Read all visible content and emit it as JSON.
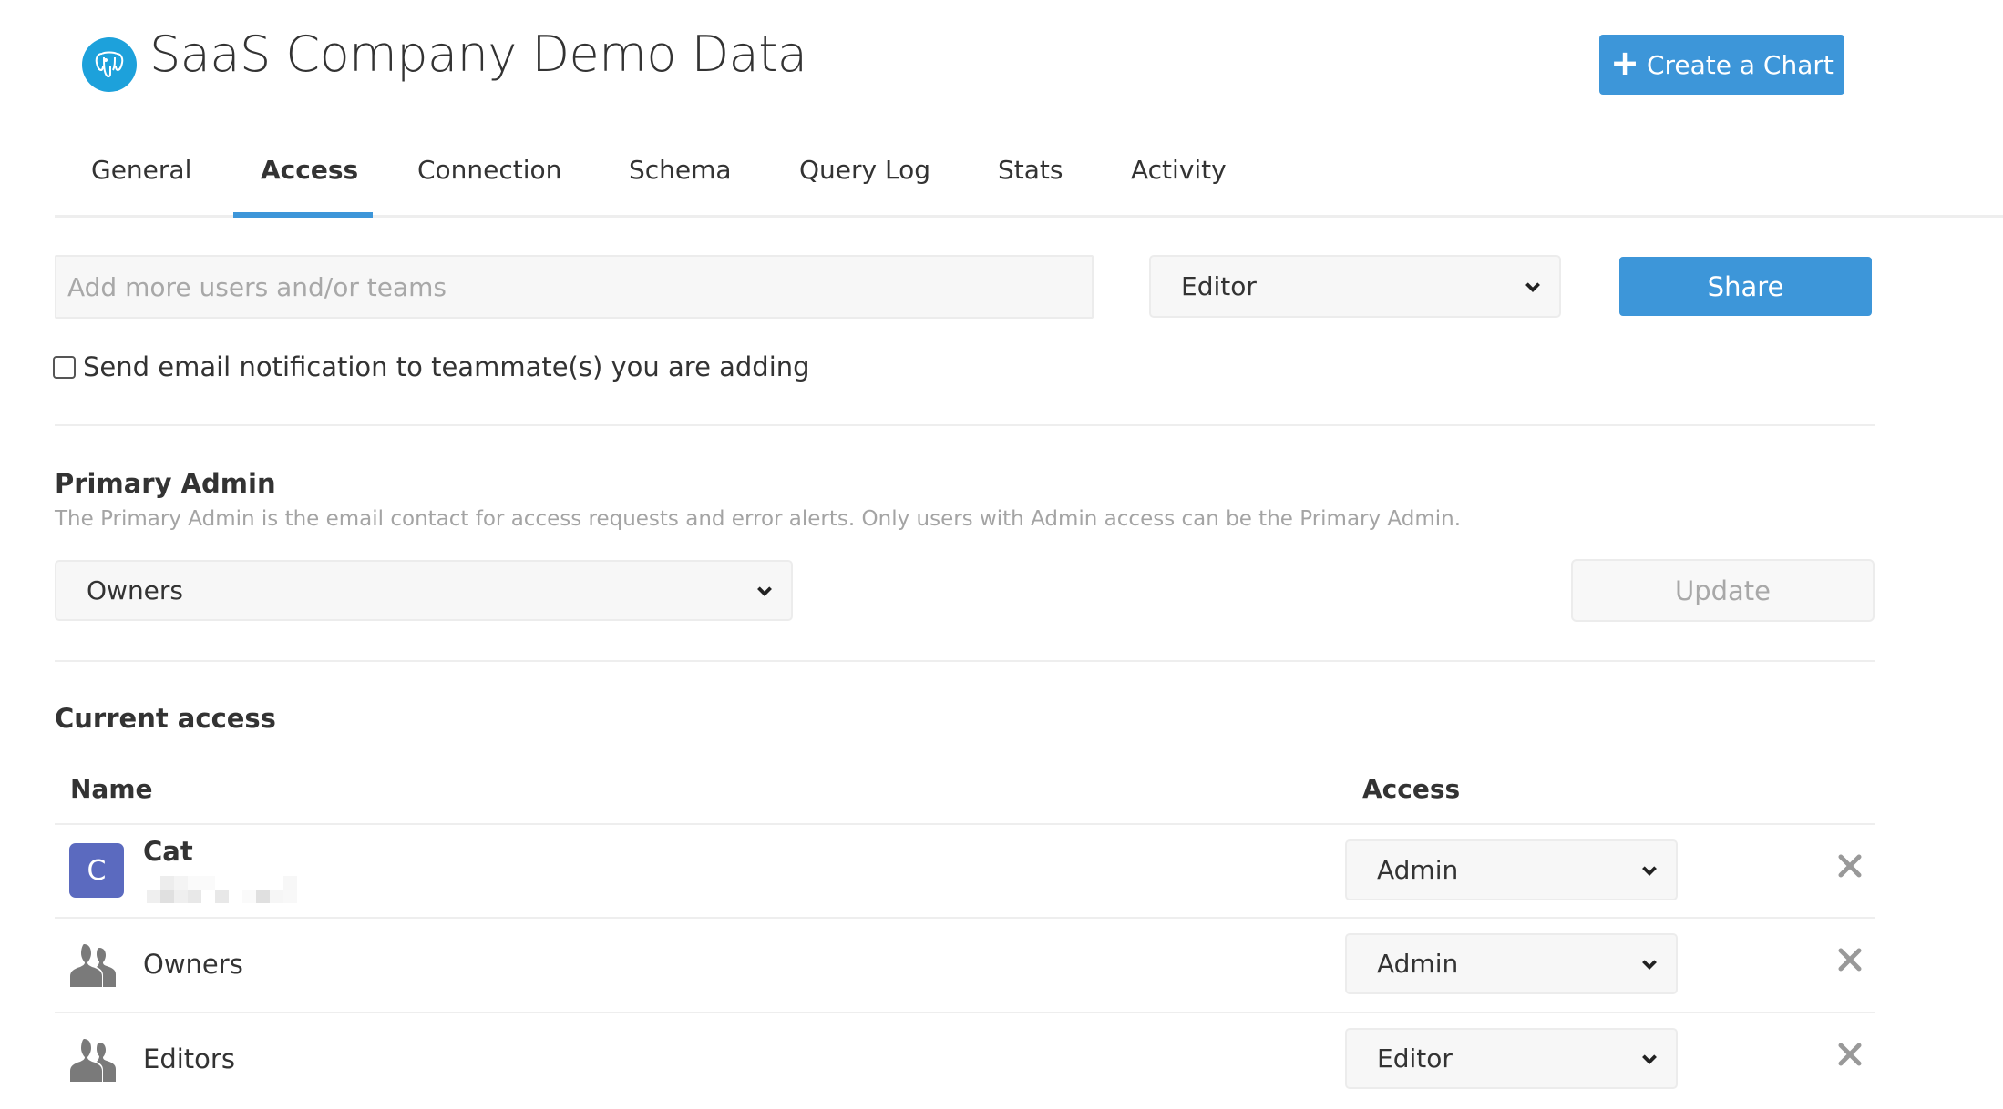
{
  "header": {
    "title": "SaaS Company Demo Data",
    "logo_icon": "postgresql-elephant-icon",
    "create_chart_label": "Create a Chart"
  },
  "tabs": [
    {
      "label": "General",
      "active": false
    },
    {
      "label": "Access",
      "active": true
    },
    {
      "label": "Connection",
      "active": false
    },
    {
      "label": "Schema",
      "active": false
    },
    {
      "label": "Query Log",
      "active": false
    },
    {
      "label": "Stats",
      "active": false
    },
    {
      "label": "Activity",
      "active": false
    }
  ],
  "share": {
    "input_placeholder": "Add more users and/or teams",
    "input_value": "",
    "role_value": "Editor",
    "share_label": "Share",
    "notify_label": "Send email notification to teammate(s) you are adding",
    "notify_checked": false
  },
  "primary_admin": {
    "title": "Primary Admin",
    "description": "The Primary Admin is the email contact for access requests and error alerts. Only users with Admin access can be the Primary Admin.",
    "selected": "Owners",
    "update_label": "Update"
  },
  "current_access": {
    "title": "Current access",
    "columns": {
      "name": "Name",
      "access": "Access"
    },
    "rows": [
      {
        "type": "user",
        "avatar_letter": "C",
        "name": "Cat",
        "email_redacted": true,
        "access": "Admin"
      },
      {
        "type": "group",
        "name": "Owners",
        "access": "Admin"
      },
      {
        "type": "group",
        "name": "Editors",
        "access": "Editor"
      }
    ]
  },
  "colors": {
    "accent": "#3d96d9",
    "logo": "#1da1db",
    "avatar": "#5b6abf"
  }
}
